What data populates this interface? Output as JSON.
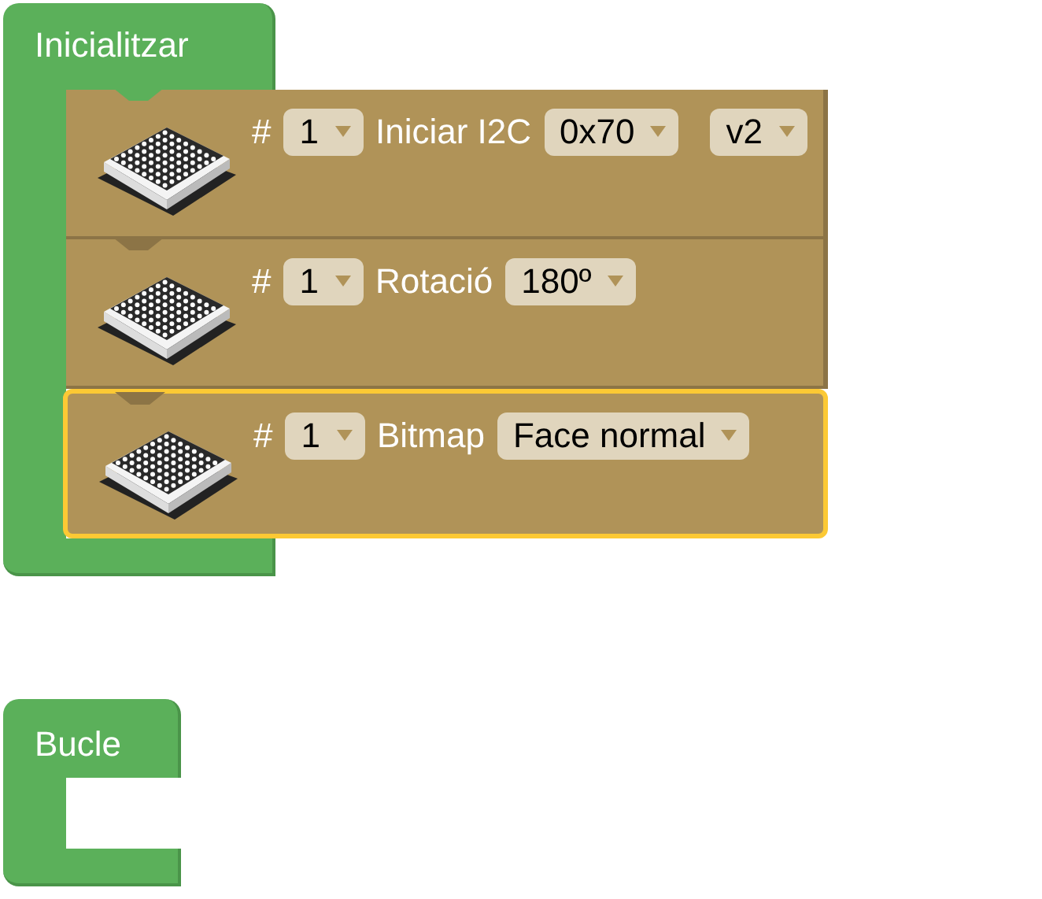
{
  "blocks": [
    {
      "label": "Inicialitzar",
      "statements": [
        {
          "selected": false,
          "fields": [
            {
              "kind": "label",
              "text": "#"
            },
            {
              "kind": "dropdown",
              "text": "1"
            },
            {
              "kind": "label",
              "text": "Iniciar I2C"
            },
            {
              "kind": "dropdown",
              "text": "0x70"
            },
            {
              "kind": "dropdown",
              "text": "v2"
            }
          ]
        },
        {
          "selected": false,
          "fields": [
            {
              "kind": "label",
              "text": "#"
            },
            {
              "kind": "dropdown",
              "text": "1"
            },
            {
              "kind": "label",
              "text": "Rotació"
            },
            {
              "kind": "dropdown",
              "text": "180º"
            }
          ]
        },
        {
          "selected": true,
          "fields": [
            {
              "kind": "label",
              "text": "#"
            },
            {
              "kind": "dropdown",
              "text": "1"
            },
            {
              "kind": "label",
              "text": "Bitmap"
            },
            {
              "kind": "dropdown",
              "text": "Face normal"
            }
          ]
        }
      ]
    },
    {
      "label": "Bucle"
    }
  ]
}
